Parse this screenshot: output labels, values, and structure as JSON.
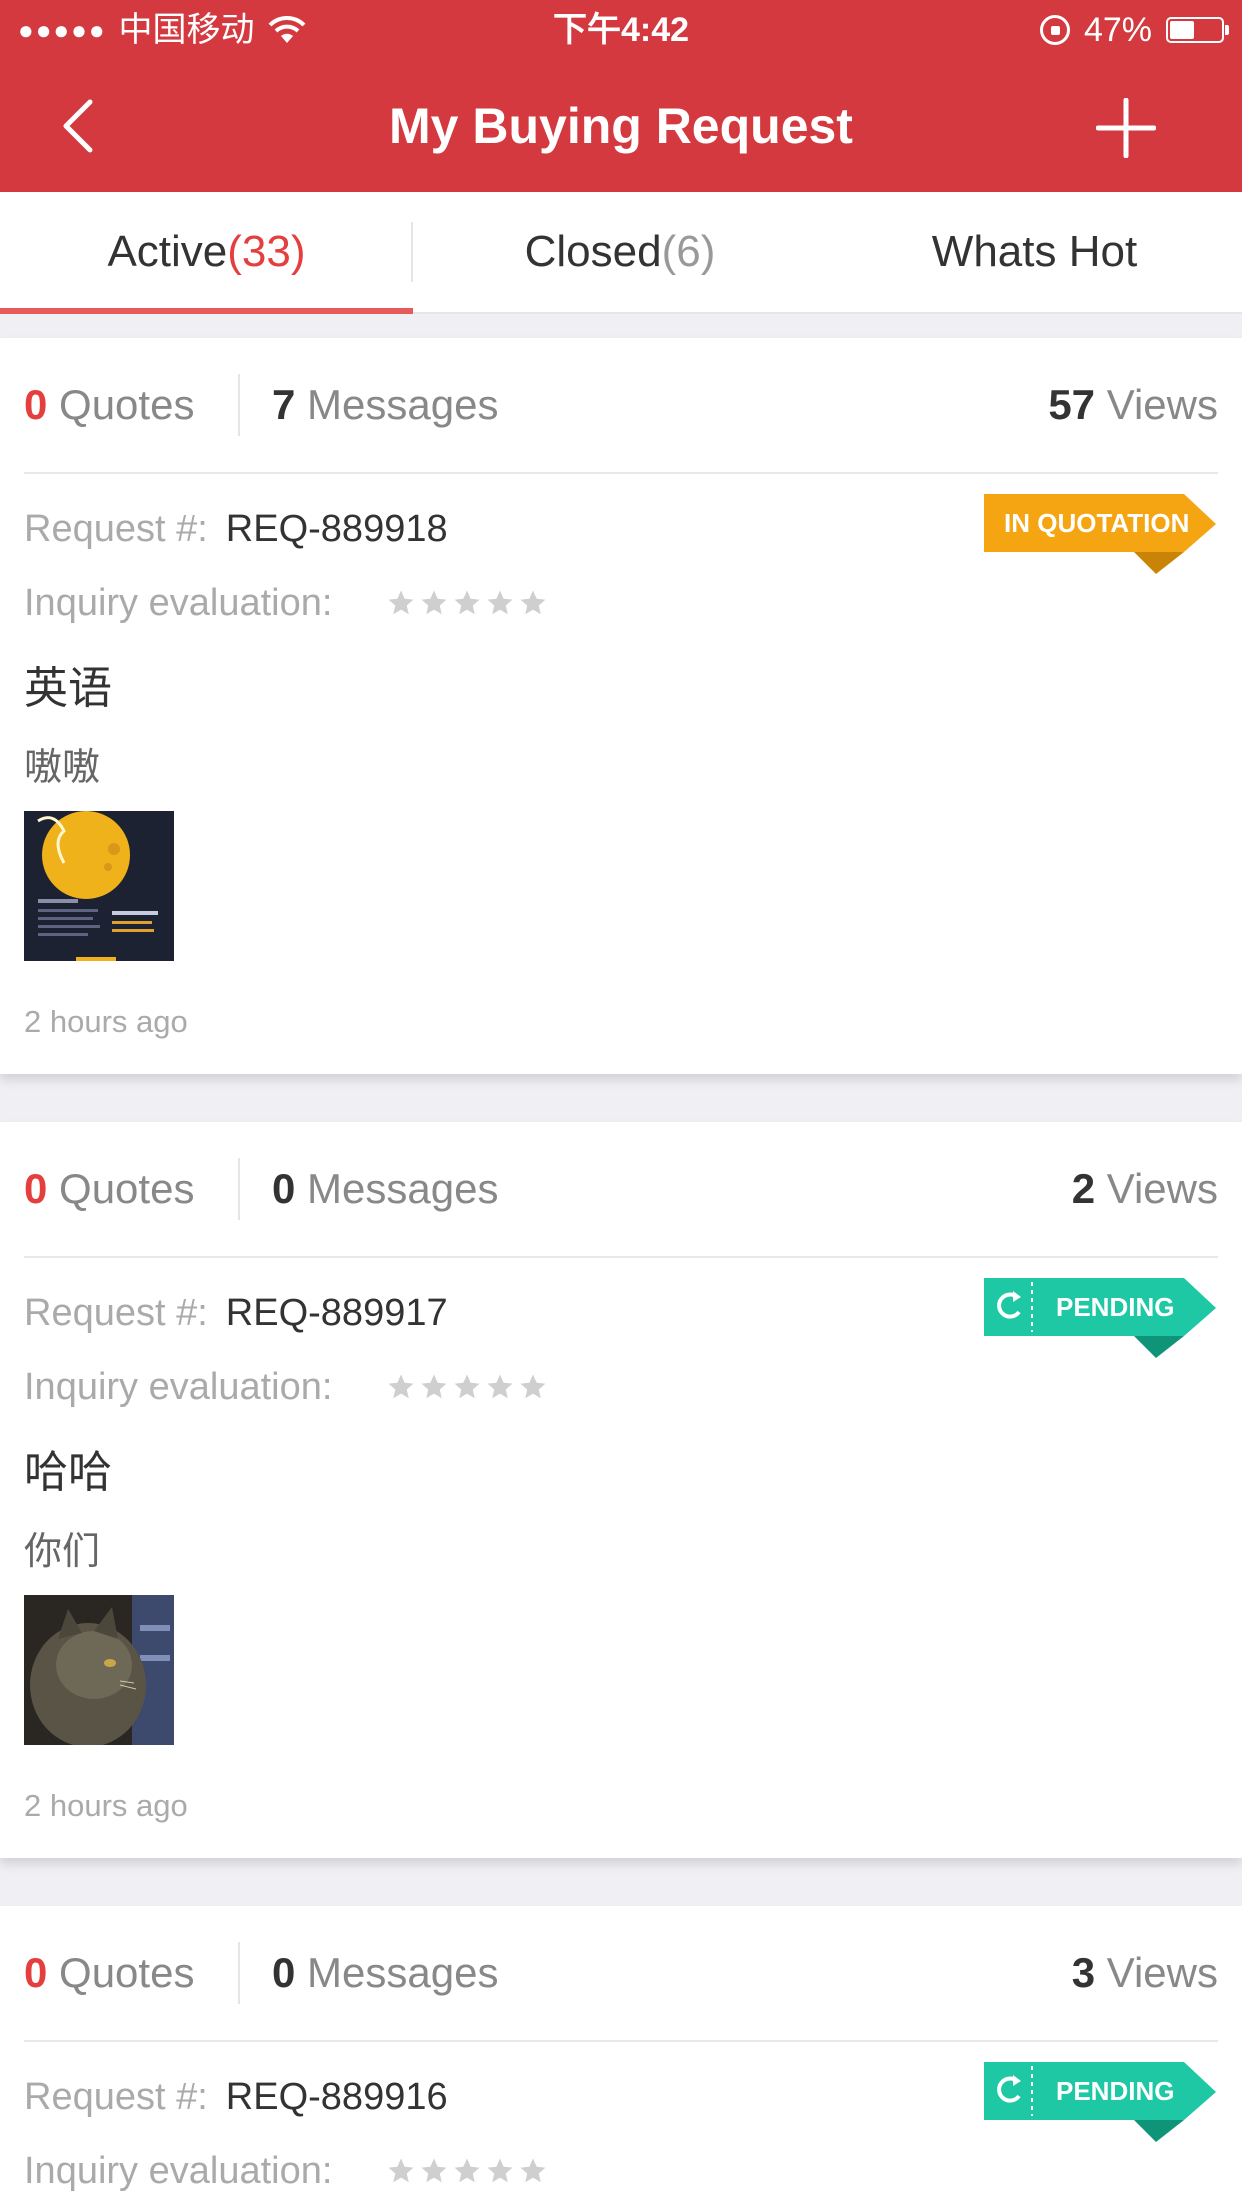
{
  "status_bar": {
    "signal": "●●●●●",
    "carrier": "中国移动",
    "time": "下午4:42",
    "battery": "47%",
    "battery_level": 0.47
  },
  "nav": {
    "title": "My Buying Request",
    "back_icon": "chevron-left-icon",
    "add_icon": "plus-icon"
  },
  "tabs": [
    {
      "label": "Active",
      "count": "(33)",
      "active": true
    },
    {
      "label": "Closed",
      "count": "(6)",
      "active": false
    },
    {
      "label": "Whats Hot",
      "count": "",
      "active": false
    }
  ],
  "labels": {
    "quotes": "Quotes",
    "messages": "Messages",
    "views": "Views",
    "request_no": "Request #:",
    "evaluation": "Inquiry evaluation:"
  },
  "colors": {
    "brand": "#d3393e",
    "accent_red": "#e53e3e",
    "in_quotation": "#f5a511",
    "pending": "#1ec8a5"
  },
  "requests": [
    {
      "quotes": "0",
      "messages": "7",
      "views": "57",
      "request_id": "REQ-889918",
      "status": "IN QUOTATION",
      "rating": 0,
      "title": "英语",
      "description": "嗷嗷",
      "thumbnail": "moon-festival-poster",
      "time": "2 hours ago"
    },
    {
      "quotes": "0",
      "messages": "0",
      "views": "2",
      "request_id": "REQ-889917",
      "status": "PENDING",
      "rating": 0,
      "title": "哈哈",
      "description": "你们",
      "thumbnail": "cat-photo",
      "time": "2 hours ago"
    },
    {
      "quotes": "0",
      "messages": "0",
      "views": "3",
      "request_id": "REQ-889916",
      "status": "PENDING",
      "rating": 0
    }
  ]
}
